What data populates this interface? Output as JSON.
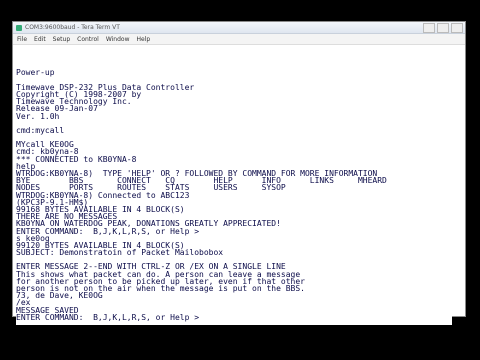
{
  "window": {
    "title": "COM3:9600baud - Tera Term VT",
    "menu": [
      "File",
      "Edit",
      "Setup",
      "Control",
      "Window",
      "Help"
    ]
  },
  "terminal": {
    "lines": [
      "",
      "",
      "Power-up",
      "",
      "Timewave DSP-232 Plus Data Controller",
      "Copyright (C) 1998-2007 by",
      "Timewave Technology Inc.",
      "Release 09-Jan-07",
      "Ver. 1.0h",
      "",
      "cmd:mycall",
      "",
      "MYcall KE0OG",
      "cmd: kb0yna-8",
      "*** CONNECTED to KB0YNA-8",
      "help",
      "WTRDOG:KB0YNA-8)  TYPE 'HELP' OR ? FOLLOWED BY COMMAND FOR MORE INFORMATION",
      "BYE        BBS       CONNECT   CQ        HELP      INFO      LINKS     MHEARD",
      "NODES      PORTS     ROUTES    STATS     USERS     SYSOP",
      "WTRDOG:KB0YNA-8) Connected to ABC123",
      "(KPC3P-9.1-HM$)",
      "99168 BYTES AVAILABLE IN 4 BLOCK(S)",
      "THERE ARE NO MESSAGES",
      "KB0YNA ON WATERDOG PEAK, DONATIONS GREATLY APPRECIATED!",
      "ENTER COMMAND:  B,J,K,L,R,S, or Help >",
      "s ke0og",
      "99120 BYTES AVAILABLE IN 4 BLOCK(S)",
      "SUBJECT: Demonstratoin of Packet Mailobobox",
      "",
      "ENTER MESSAGE 2--END WITH CTRL-Z OR /EX ON A SINGLE LINE",
      "This shows what packet can do. A person can leave a message",
      "for another person to be picked up later, even if that other",
      "person is not on the air when the message is put on the BBS.",
      "73, de Dave, KE0OG",
      "/ex",
      "MESSAGE SAVED",
      "ENTER COMMAND:  B,J,K,L,R,S, or Help >"
    ]
  }
}
